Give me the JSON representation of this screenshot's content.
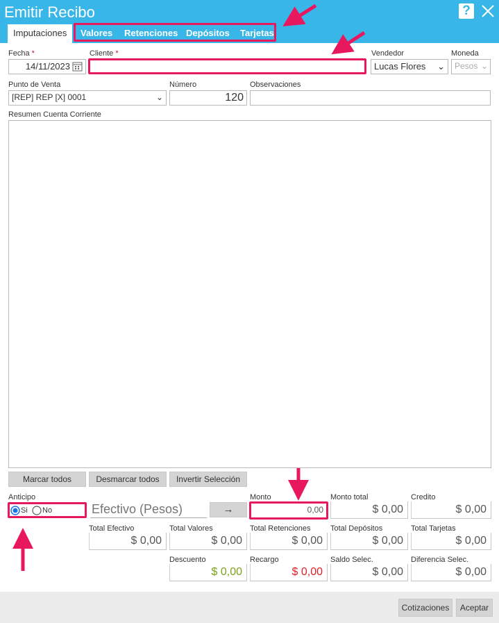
{
  "window": {
    "title": "Emitir Recibo",
    "help_label": "?"
  },
  "tabs": [
    {
      "label": "Imputaciones"
    },
    {
      "label": "Valores"
    },
    {
      "label": "Retenciones"
    },
    {
      "label": "Depósitos"
    },
    {
      "label": "Tarjetas"
    }
  ],
  "form": {
    "fecha_label": "Fecha",
    "fecha_value": "14/11/2023",
    "cliente_label": "Cliente",
    "required_mark": "*",
    "vendedor_label": "Vendedor",
    "vendedor_value": "Lucas Flores",
    "moneda_label": "Moneda",
    "moneda_value": "Pesos",
    "punto_label": "Punto de Venta",
    "punto_value": "[REP] REP [X] 0001",
    "numero_label": "Número",
    "numero_value": "120",
    "observaciones_label": "Observaciones",
    "resumen_label": "Resumen Cuenta Corriente"
  },
  "buttons": {
    "marcar": "Marcar todos",
    "desmarcar": "Desmarcar todos",
    "invertir": "Invertir Selección",
    "arrow": "→",
    "cotizaciones": "Cotizaciones",
    "aceptar": "Aceptar"
  },
  "anticipo": {
    "label": "Anticipo",
    "si": "Si",
    "no": "No",
    "selected": "Si",
    "efectivo_placeholder": "Efectivo (Pesos)"
  },
  "totals": {
    "monto_label": "Monto",
    "monto_value": "0,00",
    "monto_total_label": "Monto total",
    "monto_total_value": "$ 0,00",
    "credito_label": "Credito",
    "credito_value": "$ 0,00",
    "total_efectivo_label": "Total Efectivo",
    "total_efectivo_value": "$ 0,00",
    "total_valores_label": "Total Valores",
    "total_valores_value": "$ 0,00",
    "total_retenciones_label": "Total Retenciones",
    "total_retenciones_value": "$ 0,00",
    "total_depositos_label": "Total Depósitos",
    "total_depositos_value": "$ 0,00",
    "total_tarjetas_label": "Total Tarjetas",
    "total_tarjetas_value": "$ 0,00",
    "descuento_label": "Descuento",
    "descuento_value": "$ 0,00",
    "recargo_label": "Recargo",
    "recargo_value": "$ 0,00",
    "saldo_label": "Saldo Selec.",
    "saldo_value": "$ 0,00",
    "diferencia_label": "Diferencia Selec.",
    "diferencia_value": "$ 0,00"
  },
  "colors": {
    "titlebar": "#38b6e8",
    "highlight": "#e8185f",
    "descuento": "#7aa21a",
    "recargo": "#e0202a"
  }
}
